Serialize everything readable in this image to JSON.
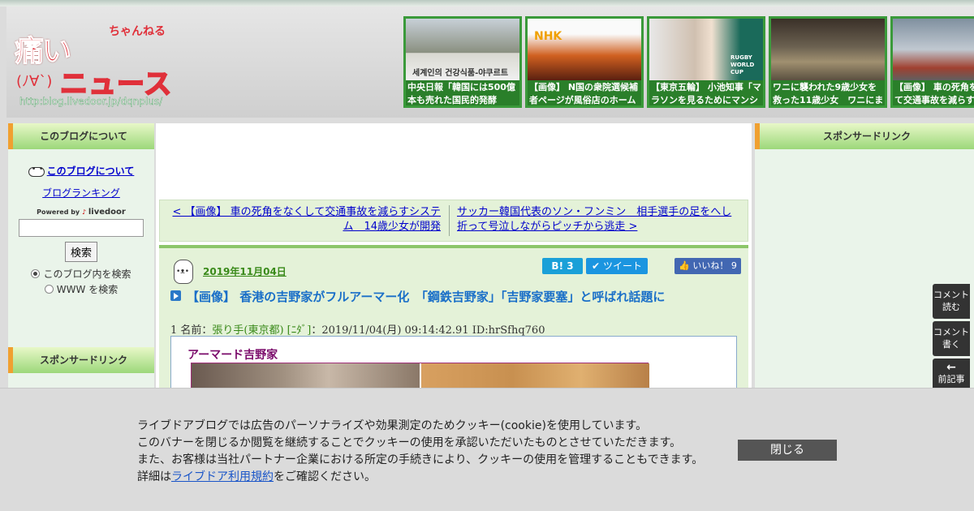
{
  "header": {
    "logo": {
      "main": "痛い",
      "sub": "ちゃんねる",
      "face": "(ﾉ∀`)",
      "news": "ニュース",
      "url": "http:blog.livedoor.jp/dqnplus/"
    },
    "thumbs": [
      {
        "caption": "中央日報「韓国には500億本も売れた国民的発酵",
        "pic": "세계인의 건강식품-야쿠르트"
      },
      {
        "caption": "【画像】 N国の衆院選候補者ページが風俗店のホーム",
        "pic": "NHK"
      },
      {
        "caption": "【東京五輪】 小池知事「マラソンを見るためにマンシ",
        "pic": "RUGBY WORLD CUP"
      },
      {
        "caption": "ワニに襲われた9歳少女を救った11歳少女　ワニにま",
        "pic": ""
      },
      {
        "caption": "【画像】 車の死角をなくして交通事故を減らす",
        "pic": ""
      }
    ]
  },
  "left": {
    "about_heading": "このブログについて",
    "about_link": "このブログについて",
    "ranking_link": "ブログランキング",
    "powered": "Powered by",
    "livedoor": "livedoor",
    "search_button": "検索",
    "radio_blog": "このブログ内を検索",
    "radio_www": "WWW を検索",
    "sponsor_heading": "スポンサードリンク"
  },
  "right": {
    "sponsor_heading": "スポンサードリンク"
  },
  "nav": {
    "prev": "< 【画像】 車の死角をなくして交通事故を減らすシステム　14歳少女が開発",
    "next": "サッカー韓国代表のソン・フンミン　相手選手の足をへし折って号泣しながらピッチから逃走 >"
  },
  "article": {
    "date": "2019年11月04日",
    "hatena": "B! 3",
    "tweet": "ツイート",
    "like": "いいね！ 9",
    "title": "【画像】 香港の吉野家がフルアーマー化　「鋼鉄吉野家」「吉野家要塞」と呼ばれ話題に",
    "res_num": "1 名前：",
    "res_name": "張り手(東京都) [ﾆﾀﾞ]",
    "res_meta": "：2019/11/04(月) 09:14:42.91 ID:hrSfhq760",
    "quote_title": "アーマード吉野家"
  },
  "floatbar": {
    "comment_read": "コメント読む",
    "comment_write": "コメント書く",
    "prev_article": "前記事"
  },
  "cookie": {
    "line1": "ライブドアブログでは広告のパーソナライズや効果測定のためクッキー(cookie)を使用しています。",
    "line2": "このバナーを閉じるか閲覧を継続することでクッキーの使用を承認いただいたものとさせていただきます。",
    "line3": "また、お客様は当社パートナー企業における所定の手続きにより、クッキーの使用を管理することもできます。",
    "line4_pre": "詳細は",
    "line4_link": "ライブドア利用規約",
    "line4_post": "をご確認ください。",
    "close": "閉じる"
  }
}
